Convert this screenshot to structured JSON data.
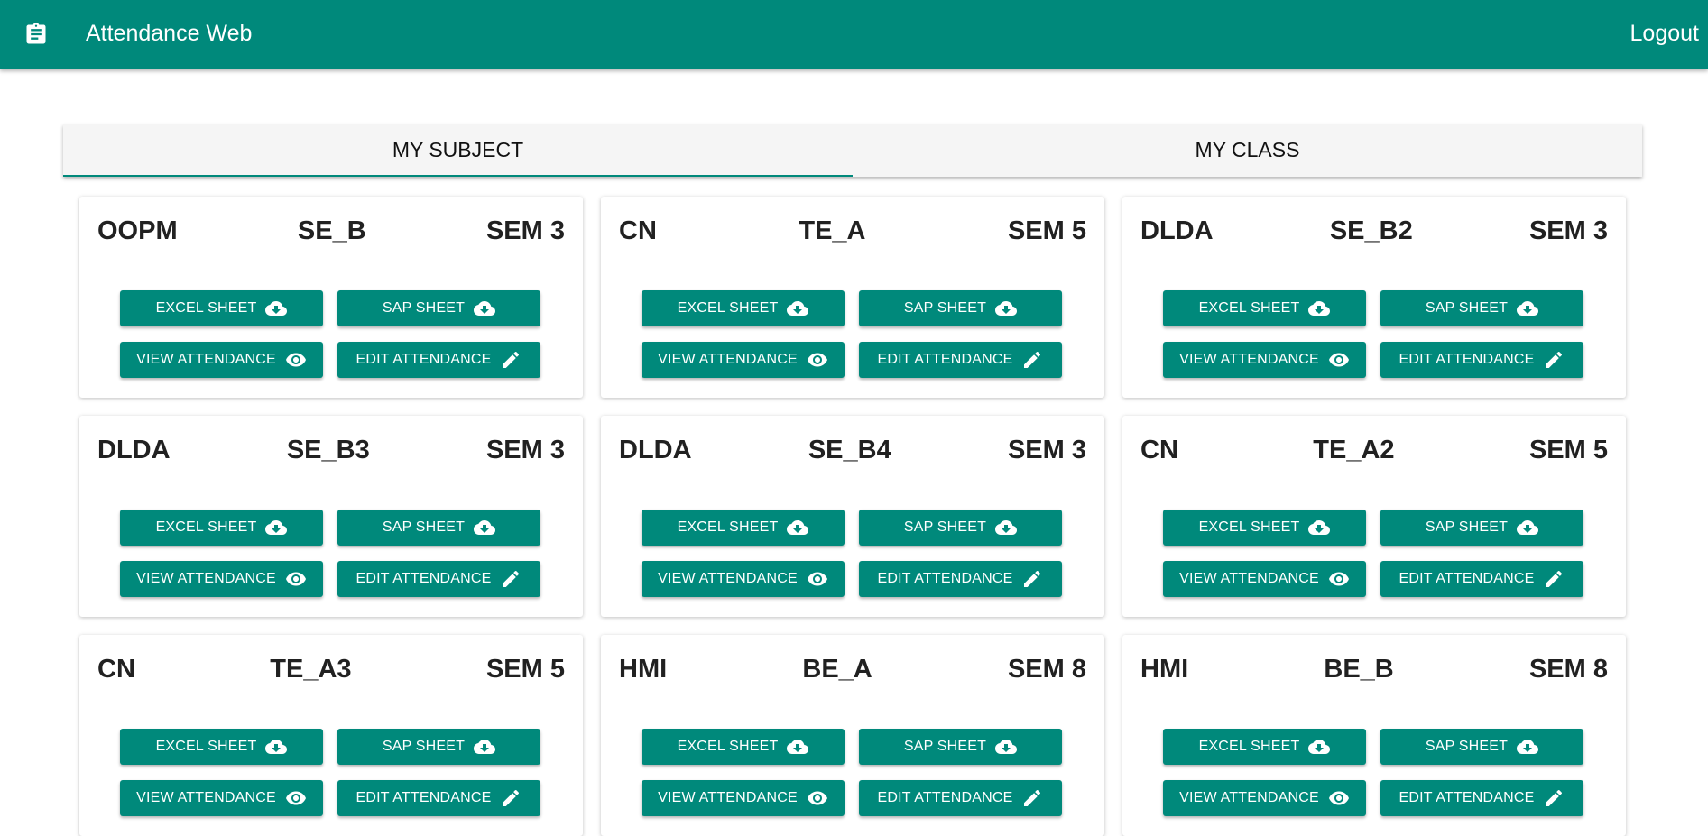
{
  "appbar": {
    "icon": "clipboard-icon",
    "title": "Attendance Web",
    "logout": "Logout"
  },
  "tabs": [
    {
      "label": "MY SUBJECT",
      "active": true
    },
    {
      "label": "MY CLASS",
      "active": false
    }
  ],
  "buttons": {
    "excel": {
      "label": "EXCEL SHEET",
      "icon": "cloud-download-icon"
    },
    "sap": {
      "label": "SAP SHEET",
      "icon": "cloud-download-icon"
    },
    "view": {
      "label": "VIEW ATTENDANCE",
      "icon": "eye-icon"
    },
    "edit": {
      "label": "EDIT ATTENDANCE",
      "icon": "pencil-icon"
    }
  },
  "cards": [
    {
      "subject": "OOPM",
      "class": "SE_B",
      "sem": "SEM 3"
    },
    {
      "subject": "CN",
      "class": "TE_A",
      "sem": "SEM 5"
    },
    {
      "subject": "DLDA",
      "class": "SE_B2",
      "sem": "SEM 3"
    },
    {
      "subject": "DLDA",
      "class": "SE_B3",
      "sem": "SEM 3"
    },
    {
      "subject": "DLDA",
      "class": "SE_B4",
      "sem": "SEM 3"
    },
    {
      "subject": "CN",
      "class": "TE_A2",
      "sem": "SEM 5"
    },
    {
      "subject": "CN",
      "class": "TE_A3",
      "sem": "SEM 5"
    },
    {
      "subject": "HMI",
      "class": "BE_A",
      "sem": "SEM 8"
    },
    {
      "subject": "HMI",
      "class": "BE_B",
      "sem": "SEM 8"
    }
  ],
  "colors": {
    "primary": "#00897b",
    "tab_background": "#f5f5f5"
  }
}
